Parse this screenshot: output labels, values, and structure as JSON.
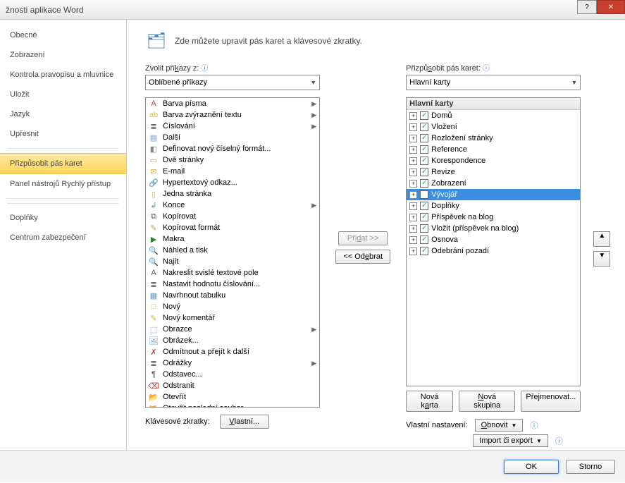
{
  "window": {
    "title": "žnosti aplikace Word"
  },
  "nav": {
    "items": [
      "Obecné",
      "Zobrazení",
      "Kontrola pravopisu a mluvnice",
      "Uložit",
      "Jazyk",
      "Upřesnit",
      "Přizpůsobit pás karet",
      "Panel nástrojů Rychlý přístup",
      "Doplňky",
      "Centrum zabezpečení"
    ],
    "selected_index": 6
  },
  "intro": "Zde můžete upravit pás karet a klávesové zkratky.",
  "left": {
    "label_html": "Zvolit příkazy z:",
    "combo": "Oblíbené příkazy",
    "commands": [
      {
        "icon": "A",
        "color": "#d33",
        "label": "Barva písma",
        "sub": true
      },
      {
        "icon": "ab",
        "color": "#d9c23a",
        "label": "Barva zvýraznění textu",
        "sub": true
      },
      {
        "icon": "≣",
        "color": "#555",
        "label": "Číslování",
        "sub": true
      },
      {
        "icon": "▤",
        "color": "#6a95c9",
        "label": "Další"
      },
      {
        "icon": "◧",
        "color": "#888",
        "label": "Definovat nový číselný formát..."
      },
      {
        "icon": "▭",
        "color": "#c9a060",
        "label": "Dvě stránky"
      },
      {
        "icon": "✉",
        "color": "#d9b040",
        "label": "E-mail"
      },
      {
        "icon": "🔗",
        "color": "#3a7bd5",
        "label": "Hypertextový odkaz..."
      },
      {
        "icon": "▯",
        "color": "#c9a060",
        "label": "Jedna stránka"
      },
      {
        "icon": "↲",
        "color": "#4a7",
        "label": "Konce",
        "sub": true
      },
      {
        "icon": "⧉",
        "color": "#555",
        "label": "Kopírovat"
      },
      {
        "icon": "✎",
        "color": "#c9a060",
        "label": "Kopírovat formát"
      },
      {
        "icon": "▶",
        "color": "#2a8a2a",
        "label": "Makra"
      },
      {
        "icon": "🔍",
        "color": "#6a95c9",
        "label": "Náhled a tisk"
      },
      {
        "icon": "🔍",
        "color": "#6a95c9",
        "label": "Najít"
      },
      {
        "icon": "A",
        "color": "#555",
        "label": "Nakreslit svislé textové pole"
      },
      {
        "icon": "≣",
        "color": "#555",
        "label": "Nastavit hodnotu číslování..."
      },
      {
        "icon": "▦",
        "color": "#6a95c9",
        "label": "Navrhnout tabulku"
      },
      {
        "icon": "□",
        "color": "#d9b040",
        "label": "Nový"
      },
      {
        "icon": "✎",
        "color": "#d9b040",
        "label": "Nový komentář"
      },
      {
        "icon": "⬚",
        "color": "#6a95c9",
        "label": "Obrazce",
        "sub": true
      },
      {
        "icon": "🖼",
        "color": "#6a95c9",
        "label": "Obrázek..."
      },
      {
        "icon": "✗",
        "color": "#c33",
        "label": "Odmítnout a přejít k další"
      },
      {
        "icon": "≣",
        "color": "#555",
        "label": "Odrážky",
        "sub": true
      },
      {
        "icon": "¶",
        "color": "#555",
        "label": "Odstavec..."
      },
      {
        "icon": "⌫",
        "color": "#c33",
        "label": "Odstranit"
      },
      {
        "icon": "📂",
        "color": "#d9b040",
        "label": "Otevřít"
      },
      {
        "icon": "📂",
        "color": "#d9b040",
        "label": "Otevřít poslední soubor..."
      }
    ]
  },
  "middle": {
    "add": "Přidat >>",
    "remove": "<< Odebrat"
  },
  "right": {
    "label_html": "Přizpůsobit pás karet:",
    "combo": "Hlavní karty",
    "tree_header": "Hlavní karty",
    "items": [
      {
        "label": "Domů",
        "checked": true
      },
      {
        "label": "Vložení",
        "checked": true
      },
      {
        "label": "Rozložení stránky",
        "checked": true
      },
      {
        "label": "Reference",
        "checked": true
      },
      {
        "label": "Korespondence",
        "checked": true
      },
      {
        "label": "Revize",
        "checked": true
      },
      {
        "label": "Zobrazení",
        "checked": true
      },
      {
        "label": "Vývojář",
        "checked": false,
        "selected": true
      },
      {
        "label": "Doplňky",
        "checked": true
      },
      {
        "label": "Příspěvek na blog",
        "checked": true
      },
      {
        "label": "Vložit (příspěvek na blog)",
        "checked": true
      },
      {
        "label": "Osnova",
        "checked": true
      },
      {
        "label": "Odebrání pozadí",
        "checked": true
      }
    ],
    "buttons": {
      "new_tab": "Nová karta",
      "new_group": "Nová skupina",
      "rename": "Přejmenovat..."
    },
    "settings_label": "Vlastní nastavení:",
    "reset": "Obnovit",
    "import": "Import či export"
  },
  "kb": {
    "label": "Klávesové zkratky:",
    "button": "Vlastní..."
  },
  "footer": {
    "ok": "OK",
    "cancel": "Storno"
  }
}
